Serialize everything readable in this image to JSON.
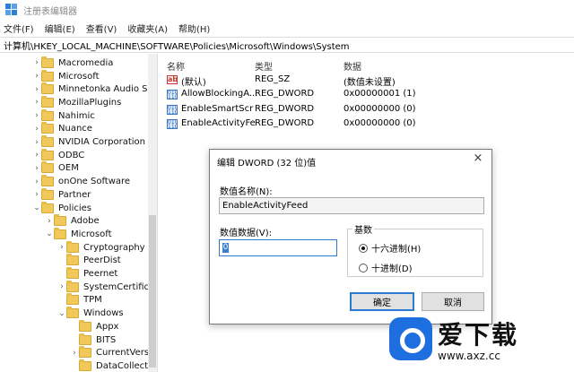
{
  "window": {
    "title": "注册表编辑器"
  },
  "menu": [
    "文件(F)",
    "编辑(E)",
    "查看(V)",
    "收藏夹(A)",
    "帮助(H)"
  ],
  "address": "计算机\\HKEY_LOCAL_MACHINE\\SOFTWARE\\Policies\\Microsoft\\Windows\\System",
  "tree": [
    {
      "label": "Macromedia",
      "chev": "›"
    },
    {
      "label": "Microsoft",
      "chev": "›"
    },
    {
      "label": "Minnetonka Audio S",
      "chev": "›"
    },
    {
      "label": "MozillaPlugins",
      "chev": "›"
    },
    {
      "label": "Nahimic",
      "chev": "›"
    },
    {
      "label": "Nuance",
      "chev": "›"
    },
    {
      "label": "NVIDIA Corporation",
      "chev": "›"
    },
    {
      "label": "ODBC",
      "chev": "›"
    },
    {
      "label": "OEM",
      "chev": "›"
    },
    {
      "label": "onOne Software",
      "chev": "›"
    },
    {
      "label": "Partner",
      "chev": "›"
    },
    {
      "label": "Policies",
      "chev": "⌄"
    },
    {
      "label": "Adobe",
      "chev": "›"
    },
    {
      "label": "Microsoft",
      "chev": "⌄"
    },
    {
      "label": "Cryptography",
      "chev": "›"
    },
    {
      "label": "PeerDist",
      "chev": ""
    },
    {
      "label": "Peernet",
      "chev": ""
    },
    {
      "label": "SystemCertific",
      "chev": "›"
    },
    {
      "label": "TPM",
      "chev": ""
    },
    {
      "label": "Windows",
      "chev": "⌄"
    },
    {
      "label": "Appx",
      "chev": ""
    },
    {
      "label": "BITS",
      "chev": ""
    },
    {
      "label": "CurrentVers",
      "chev": "›"
    },
    {
      "label": "DataCollect",
      "chev": ""
    }
  ],
  "columns": {
    "name": "名称",
    "type": "类型",
    "data": "数据"
  },
  "values": [
    {
      "icon": "ab",
      "name": "(默认)",
      "type": "REG_SZ",
      "data": "(数值未设置)"
    },
    {
      "icon": "bin",
      "name": "AllowBlockingA...",
      "type": "REG_DWORD",
      "data": "0x00000001 (1)"
    },
    {
      "icon": "bin",
      "name": "EnableSmartScr",
      "type": "REG_DWORD",
      "data": "0x00000000 (0)"
    },
    {
      "icon": "bin",
      "name": "EnableActivityFe",
      "type": "REG_DWORD",
      "data": "0x00000000 (0)"
    }
  ],
  "dialog": {
    "title": "编辑 DWORD (32 位)值",
    "name_label": "数值名称(N):",
    "name_value": "EnableActivityFeed",
    "data_label": "数值数据(V):",
    "data_value": "0",
    "base_label": "基数",
    "hex_label": "十六进制(H)",
    "dec_label": "十进制(D)",
    "hex_selected": true,
    "ok": "确定",
    "cancel": "取消",
    "close": "×"
  },
  "watermark": {
    "brand": "爱下载",
    "url": "www.axz.cc"
  }
}
